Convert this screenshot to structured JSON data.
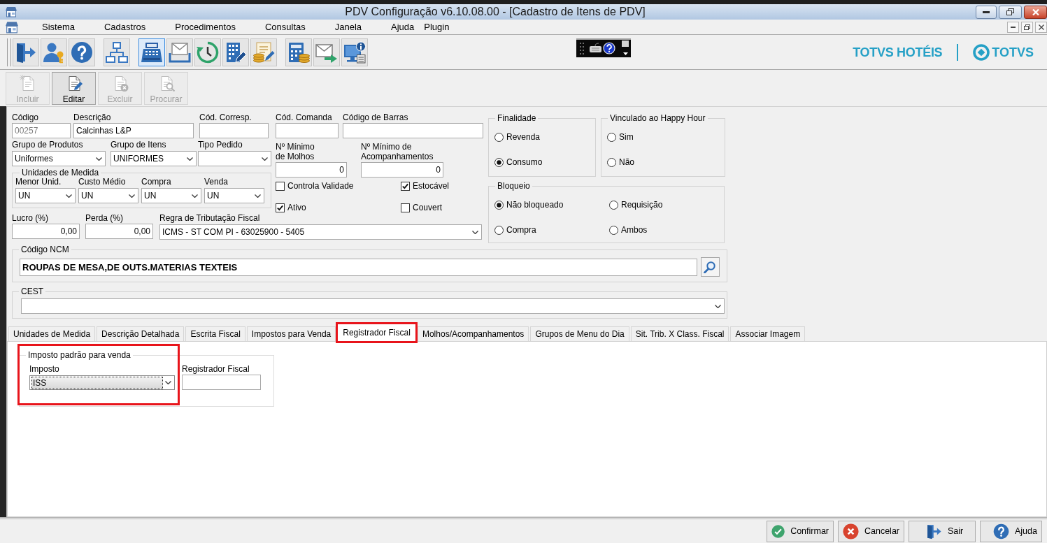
{
  "window": {
    "title": "PDV Configuração v6.10.08.00 - [Cadastro de Itens de PDV]"
  },
  "menu": [
    "Sistema",
    "Cadastros",
    "Procedimentos",
    "Consultas",
    "Janela",
    "Ajuda",
    "Plugin"
  ],
  "toolbar": {
    "groups": [
      [
        {
          "selected": false
        },
        {
          "selected": false
        },
        {
          "selected": false
        }
      ],
      [
        {
          "selected": false
        }
      ],
      [
        {
          "selected": true
        },
        {
          "selected": false
        },
        {
          "selected": false
        },
        {
          "selected": false
        },
        {
          "selected": false
        }
      ],
      [
        {
          "selected": false
        },
        {
          "selected": false
        },
        {
          "selected": false
        }
      ]
    ]
  },
  "brand": {
    "product": "TOTVS HOTÉIS",
    "logo_text": "TOTVS"
  },
  "actions": [
    {
      "label": "Incluir",
      "disabled": true
    },
    {
      "label": "Editar",
      "disabled": false
    },
    {
      "label": "Excluir",
      "disabled": true
    },
    {
      "label": "Procurar",
      "disabled": true
    }
  ],
  "form": {
    "codigo": {
      "label": "Código",
      "value": "00257",
      "read_only": true
    },
    "descricao": {
      "label": "Descrição",
      "value": "Calcinhas L&P"
    },
    "cod_corresp": {
      "label": "Cód. Corresp."
    },
    "cod_comanda": {
      "label": "Cód. Comanda"
    },
    "codigo_barras": {
      "label": "Código de Barras"
    },
    "grupo_produtos": {
      "label": "Grupo de Produtos",
      "value": "Uniformes"
    },
    "grupo_itens": {
      "label": "Grupo de Itens",
      "value": "UNIFORMES"
    },
    "tipo_pedido": {
      "label": "Tipo Pedido"
    },
    "min_molhos": {
      "label": "Nº Mínimo de Molhos",
      "value": "0"
    },
    "min_acompanhamentos": {
      "label": "Nº Mínimo de Acompanhamentos",
      "value": "0"
    },
    "unidades_medida": {
      "title": "Unidades de Medida",
      "fields": [
        {
          "label": "Menor Unid.",
          "value": "UN"
        },
        {
          "label": "Custo Médio",
          "value": "UN"
        },
        {
          "label": "Compra",
          "value": "UN"
        },
        {
          "label": "Venda",
          "value": "UN"
        }
      ]
    },
    "checkboxes": [
      {
        "label": "Controla Validade",
        "checked": false
      },
      {
        "label": "Estocável",
        "checked": true
      },
      {
        "label": "Ativo",
        "checked": true
      },
      {
        "label": "Couvert",
        "checked": false
      }
    ],
    "lucro": {
      "label": "Lucro (%)",
      "value": "0,00"
    },
    "perda": {
      "label": "Perda (%)",
      "value": "0,00"
    },
    "regra_tributacao": {
      "label": "Regra de Tributação Fiscal",
      "value": "ICMS - ST COM PI - 63025900 - 5405"
    },
    "finalidade": {
      "title": "Finalidade",
      "options": [
        {
          "label": "Revenda",
          "selected": false
        },
        {
          "label": "Consumo",
          "selected": true
        }
      ]
    },
    "happy_hour": {
      "title": "Vinculado ao Happy Hour",
      "options": [
        {
          "label": "Sim",
          "selected": false
        },
        {
          "label": "Não",
          "selected": false
        }
      ]
    },
    "bloqueio": {
      "title": "Bloqueio",
      "options": [
        {
          "label": "Não bloqueado",
          "selected": true
        },
        {
          "label": "Requisição",
          "selected": false
        },
        {
          "label": "Compra",
          "selected": false
        },
        {
          "label": "Ambos",
          "selected": false
        }
      ]
    },
    "ncm": {
      "title": "Código NCM",
      "value": "ROUPAS DE MESA,DE OUTS.MATERIAS TEXTEIS"
    },
    "cest": {
      "title": "CEST"
    }
  },
  "tabs": [
    {
      "label": "Unidades de Medida",
      "selected": false,
      "highlighted": false
    },
    {
      "label": "Descrição Detalhada",
      "selected": false,
      "highlighted": false
    },
    {
      "label": "Escrita Fiscal",
      "selected": false,
      "highlighted": false
    },
    {
      "label": "Impostos para Venda",
      "selected": false,
      "highlighted": false
    },
    {
      "label": "Registrador Fiscal",
      "selected": true,
      "highlighted": true
    },
    {
      "label": "Molhos/Acompanhamentos",
      "selected": false,
      "highlighted": false
    },
    {
      "label": "Grupos de Menu do Dia",
      "selected": false,
      "highlighted": false
    },
    {
      "label": "Sit. Trib. X Class. Fiscal",
      "selected": false,
      "highlighted": false
    },
    {
      "label": "Associar Imagem",
      "selected": false,
      "highlighted": false
    }
  ],
  "tab_panel": {
    "group": {
      "title": "Imposto padrão para venda",
      "highlighted": true,
      "imposto": {
        "label": "Imposto",
        "value": "ISS",
        "focused": true
      },
      "registrador": {
        "label": "Registrador Fiscal"
      }
    }
  },
  "footer_buttons": [
    "Confirmar",
    "Cancelar",
    "Sair",
    "Ajuda"
  ]
}
